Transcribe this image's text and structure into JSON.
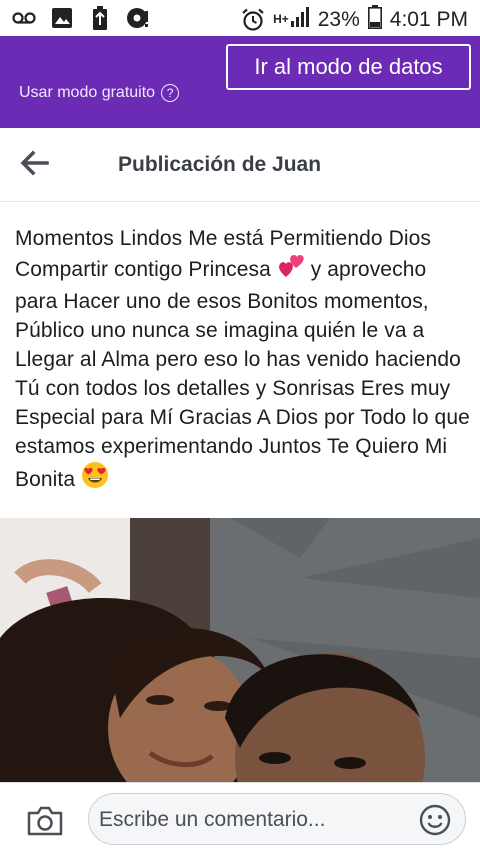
{
  "status_bar": {
    "icons_left": [
      "voicemail-icon",
      "image-icon",
      "battery-saver-icon",
      "download-icon"
    ],
    "alarm_icon": "alarm-icon",
    "network_label": "H+",
    "signal_icon": "signal-icon",
    "battery_percent": "23%",
    "battery_icon": "battery-icon",
    "time": "4:01 PM"
  },
  "promo": {
    "free_mode_label": "Usar modo gratuito",
    "help_icon": "help-icon",
    "data_mode_button": "Ir al modo de datos",
    "background_color": "#6b2bb4"
  },
  "header": {
    "back_icon": "back-arrow-icon",
    "title": "Publicación de Juan"
  },
  "post": {
    "text_part1": "Momentos Lindos Me está Permitiendo Dios Compartir contigo Princesa ",
    "emoji1": "💕",
    "text_part2": " y aprovecho para Hacer uno de esos Bonitos momentos, Público uno nunca se imagina quién le va a Llegar al Alma pero eso lo has venido haciendo Tú con todos los detalles y Sonrisas Eres muy Especial para Mí Gracias A Dios por Todo lo que estamos experimentando Juntos Te Quiero Mi Bonita ",
    "emoji2": "😍"
  },
  "comment_bar": {
    "camera_icon": "camera-icon",
    "placeholder": "Escribe un comentario...",
    "emoji_icon": "smiley-icon"
  }
}
